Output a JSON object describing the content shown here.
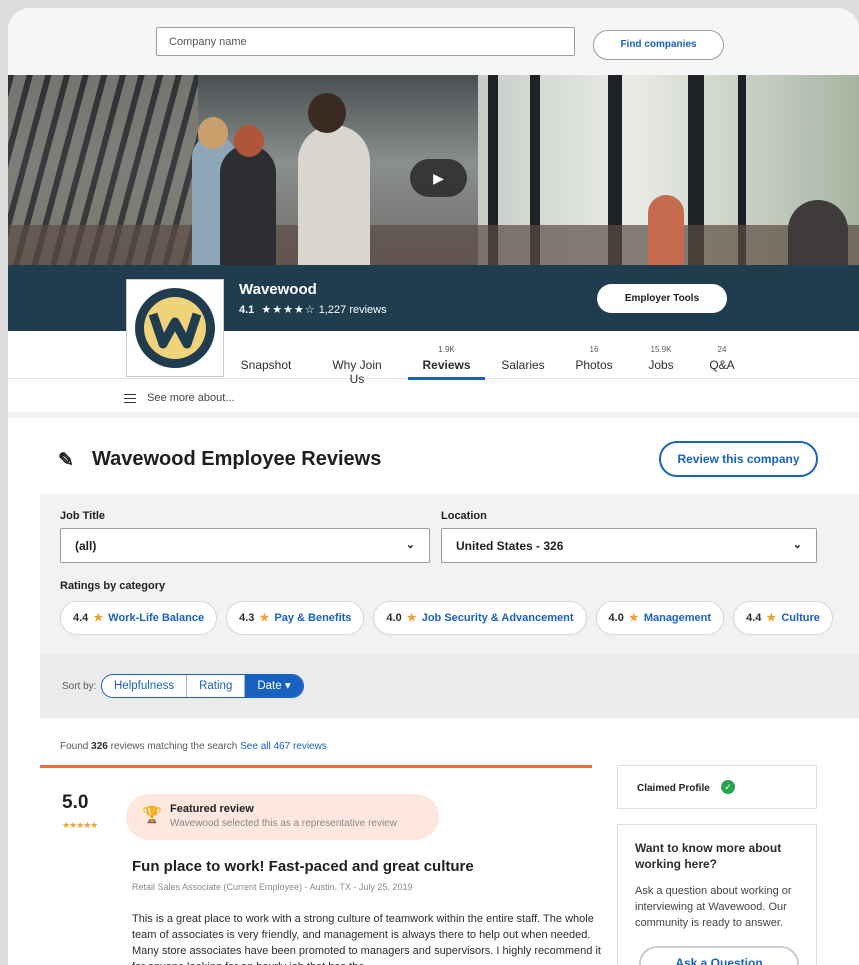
{
  "search": {
    "placeholder": "Company name",
    "button": "Find companies"
  },
  "hero": {
    "play_icon": "play-icon"
  },
  "company": {
    "name": "Wavewood",
    "rating": "4.1",
    "stars": "★★★★☆",
    "reviews": "1,227 reviews",
    "employer_tools": "Employer Tools",
    "logo_letter": "W",
    "colors": {
      "band": "#203d4f",
      "logo_yellow": "#f0d27a",
      "logo_ring": "#203d4f"
    }
  },
  "tabs": [
    {
      "count": "",
      "label": "Snapshot"
    },
    {
      "count": "",
      "label": "Why Join Us"
    },
    {
      "count": "1.9K",
      "label": "Reviews",
      "active": true
    },
    {
      "count": "",
      "label": "Salaries"
    },
    {
      "count": "16",
      "label": "Photos"
    },
    {
      "count": "15.9K",
      "label": "Jobs"
    },
    {
      "count": "24",
      "label": "Q&A"
    }
  ],
  "see_more": "See more about...",
  "reviews_header": {
    "title": "Wavewood Employee Reviews",
    "button": "Review this company"
  },
  "filters": {
    "job_title_label": "Job Title",
    "job_title_value": "(all)",
    "location_label": "Location",
    "location_value": "United States - 326",
    "ratings_label": "Ratings by category",
    "categories": [
      {
        "score": "4.4",
        "name": "Work-Life Balance"
      },
      {
        "score": "4.3",
        "name": "Pay & Benefits"
      },
      {
        "score": "4.0",
        "name": "Job Security & Advancement"
      },
      {
        "score": "4.0",
        "name": "Management"
      },
      {
        "score": "4.4",
        "name": "Culture"
      }
    ]
  },
  "sort": {
    "label": "Sort by:",
    "options": [
      "Helpfulness",
      "Rating",
      "Date ▾"
    ],
    "selected": "Date"
  },
  "found": {
    "prefix": "Found",
    "count": "326",
    "middle": "reviews matching the search",
    "link": "See all 467 reviews"
  },
  "review": {
    "score": "5.0",
    "stars": "★★★★★",
    "featured_title": "Featured review",
    "featured_sub": "Wavewood selected this as a representative review",
    "title": "Fun place to work! Fast-paced and great culture",
    "meta": "Retail Sales Associate (Current Employee) - Austin, TX - July 25, 2019",
    "body": "This is a great place to work with a strong culture of teamwork within the entire staff. The whole team of associates is very friendly, and management is always there to help out when needed. Many store associates have been promoted to managers and supervisors. I highly recommend it for anyone looking for an hourly job that has the"
  },
  "sidebar": {
    "claimed": "Claimed Profile",
    "ask_title": "Want to know more about working here?",
    "ask_desc": "Ask a question about working or interviewing at Wavewood. Our community is ready to answer.",
    "ask_button": "Ask a Question"
  }
}
